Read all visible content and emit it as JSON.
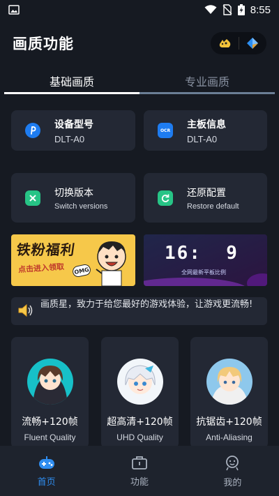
{
  "status_bar": {
    "time": "8:55"
  },
  "header": {
    "title": "画质功能"
  },
  "tabs": [
    {
      "label": "基础画质"
    },
    {
      "label": "专业画质"
    }
  ],
  "info_cards": [
    {
      "title": "设备型号",
      "value": "DLT-A0",
      "icon": "p-logo-icon"
    },
    {
      "title": "主板信息",
      "value": "DLT-A0",
      "icon": "ocr-icon",
      "icon_text": "OCR"
    }
  ],
  "action_cards": [
    {
      "title": "切换版本",
      "subtitle": "Switch versions",
      "icon": "switch-icon"
    },
    {
      "title": "还原配置",
      "subtitle": "Restore default",
      "icon": "restore-icon"
    }
  ],
  "banners": {
    "left": {
      "text1": "铁粉福利",
      "text2": "点击进入领取",
      "badge": "OMG"
    },
    "right": {
      "ratio": "16:  9",
      "caption": "全网最新平板比例"
    }
  },
  "notice": {
    "text": "画质星，致力于给您最好的游戏体验，让游戏更流畅!"
  },
  "modes": [
    {
      "name": "流畅+120帧",
      "sub": "Fluent Quality"
    },
    {
      "name": "超高清+120帧",
      "sub": "UHD Quality"
    },
    {
      "name": "抗锯齿+120帧",
      "sub": "Anti-Aliasing"
    }
  ],
  "bottom_nav": [
    {
      "label": "首页"
    },
    {
      "label": "功能"
    },
    {
      "label": "我的"
    }
  ],
  "colors": {
    "accent": "#2f8df0",
    "card": "#232834",
    "background": "#161a22"
  }
}
